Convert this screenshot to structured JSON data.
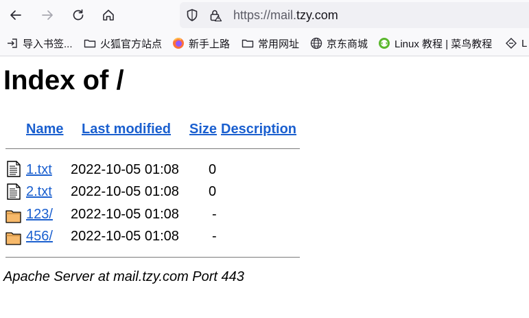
{
  "browser": {
    "url_prefix": "https://mail.",
    "url_host": "tzy.com"
  },
  "bookmarks": [
    {
      "label": "导入书签...",
      "icon": "import-icon"
    },
    {
      "label": "火狐官方站点",
      "icon": "folder-icon"
    },
    {
      "label": "新手上路",
      "icon": "firefox-icon"
    },
    {
      "label": "常用网址",
      "icon": "folder-icon"
    },
    {
      "label": "京东商城",
      "icon": "globe-icon"
    },
    {
      "label": "Linux 教程 | 菜鸟教程",
      "icon": "runoob-icon"
    },
    {
      "label": "L",
      "icon": "link-icon"
    }
  ],
  "page": {
    "title": "Index of /",
    "columns": {
      "name": "Name",
      "last_modified": "Last modified",
      "size": "Size",
      "description": "Description"
    },
    "rows": [
      {
        "name": "1.txt",
        "modified": "2022-10-05 01:08",
        "size": "0",
        "type": "file"
      },
      {
        "name": "2.txt",
        "modified": "2022-10-05 01:08",
        "size": "0",
        "type": "file"
      },
      {
        "name": "123/",
        "modified": "2022-10-05 01:08",
        "size": "-",
        "type": "folder"
      },
      {
        "name": "456/",
        "modified": "2022-10-05 01:08",
        "size": "-",
        "type": "folder"
      }
    ],
    "footer": "Apache Server at mail.tzy.com Port 443"
  },
  "colors": {
    "link": "#1a5fcf",
    "toolbar_bg": "#f9f9fb",
    "urlbar_bg": "#f0f0f4"
  }
}
